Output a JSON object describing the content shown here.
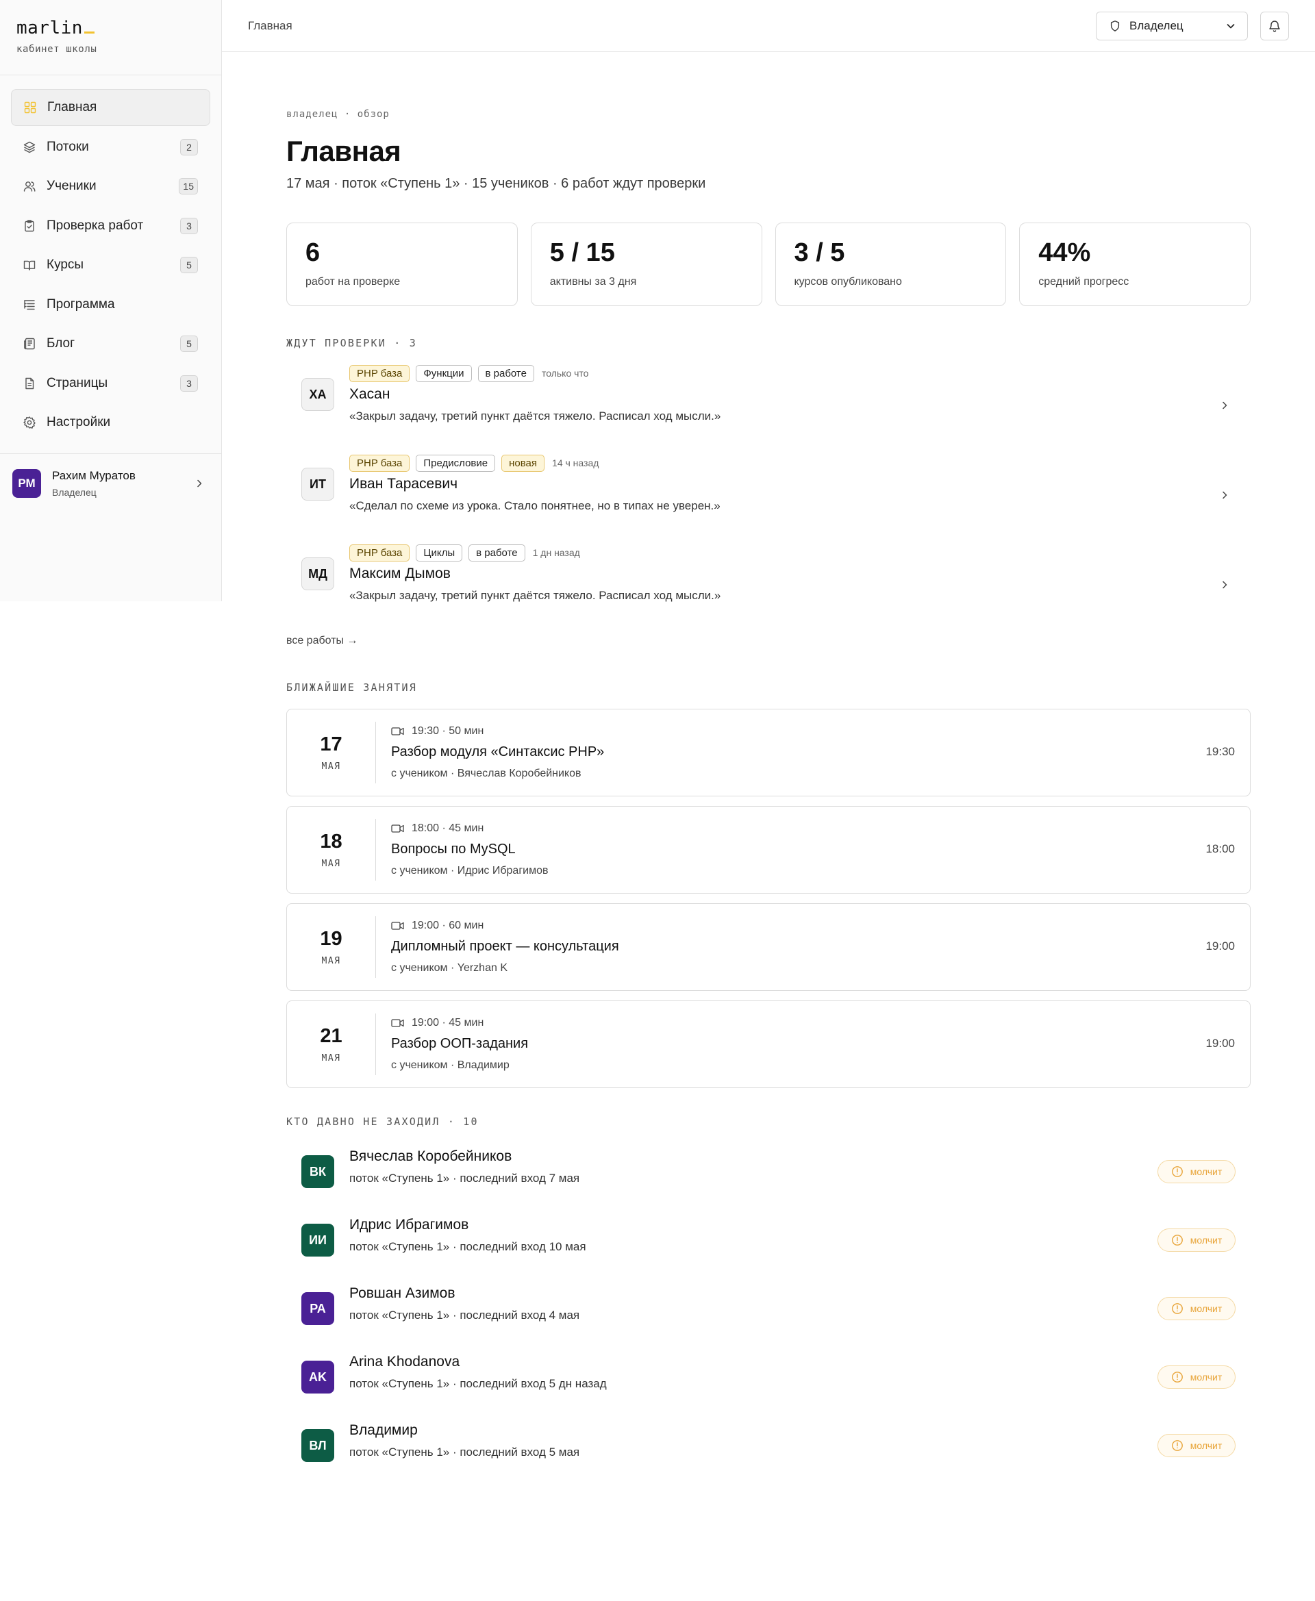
{
  "brand": {
    "name": "marlin",
    "subtitle": "кабинет школы"
  },
  "sidebar": {
    "items": [
      {
        "label": "Главная",
        "icon": "grid-icon",
        "active": true
      },
      {
        "label": "Потоки",
        "icon": "layers-icon",
        "badge": "2"
      },
      {
        "label": "Ученики",
        "icon": "users-icon",
        "badge": "15"
      },
      {
        "label": "Проверка работ",
        "icon": "clipboard-check-icon",
        "badge": "3"
      },
      {
        "label": "Курсы",
        "icon": "book-open-icon",
        "badge": "5"
      },
      {
        "label": "Программа",
        "icon": "list-tree-icon"
      },
      {
        "label": "Блог",
        "icon": "newspaper-icon",
        "badge": "5"
      },
      {
        "label": "Страницы",
        "icon": "file-text-icon",
        "badge": "3"
      },
      {
        "label": "Настройки",
        "icon": "gear-icon"
      }
    ],
    "profile": {
      "initials": "РМ",
      "name": "Рахим Муратов",
      "role": "Владелец"
    }
  },
  "topbar": {
    "breadcrumb": "Главная",
    "role_select": "Владелец"
  },
  "main": {
    "eyebrow": "владелец · обзор",
    "title": "Главная",
    "subtitle": "17 мая · поток «Ступень 1» · 15 учеников · 6 работ ждут проверки",
    "stats": [
      {
        "value": "6",
        "label": "работ на проверке"
      },
      {
        "value": "5 / 15",
        "label": "активны за 3 дня"
      },
      {
        "value": "3 / 5",
        "label": "курсов опубликовано"
      },
      {
        "value": "44%",
        "label": "средний прогресс"
      }
    ],
    "reviews_heading": "ЖДУТ ПРОВЕРКИ · 3",
    "reviews": [
      {
        "initials": "ХА",
        "course": "PHP база",
        "lesson": "Функции",
        "status": "в работе",
        "status_highlight": false,
        "time": "только что",
        "name": "Хасан",
        "quote": "«Закрыл задачу, третий пункт даётся тяжело. Расписал ход мысли.»"
      },
      {
        "initials": "ИТ",
        "course": "PHP база",
        "lesson": "Предисловие",
        "status": "новая",
        "status_highlight": true,
        "time": "14 ч назад",
        "name": "Иван Тарасевич",
        "quote": "«Сделал по схеме из урока. Стало понятнее, но в типах не уверен.»"
      },
      {
        "initials": "МД",
        "course": "PHP база",
        "lesson": "Циклы",
        "status": "в работе",
        "status_highlight": false,
        "time": "1 дн назад",
        "name": "Максим Дымов",
        "quote": "«Закрыл задачу, третий пункт даётся тяжело. Расписал ход мысли.»"
      }
    ],
    "all_works_link": "все работы →",
    "lessons_heading": "БЛИЖАЙШИЕ ЗАНЯТИЯ",
    "lessons": [
      {
        "day": "17",
        "month": "МАЯ",
        "meta": "19:30 · 50 мин",
        "title": "Разбор модуля «Синтаксис PHP»",
        "with": "с учеником · Вячеслав Коробейников",
        "time": "19:30"
      },
      {
        "day": "18",
        "month": "МАЯ",
        "meta": "18:00 · 45 мин",
        "title": "Вопросы по MySQL",
        "with": "с учеником · Идрис Ибрагимов",
        "time": "18:00"
      },
      {
        "day": "19",
        "month": "МАЯ",
        "meta": "19:00 · 60 мин",
        "title": "Дипломный проект — консультация",
        "with": "с учеником · Yerzhan K",
        "time": "19:00"
      },
      {
        "day": "21",
        "month": "МАЯ",
        "meta": "19:00 · 45 мин",
        "title": "Разбор ООП-задания",
        "with": "с учеником · Владимир",
        "time": "19:00"
      }
    ],
    "absent_heading": "КТО ДАВНО НЕ ЗАХОДИЛ · 10",
    "absent": [
      {
        "initials": "ВК",
        "color": "#0d5c45",
        "name": "Вячеслав Коробейников",
        "sub": "поток «Ступень 1» · последний вход 7 мая",
        "status": "молчит"
      },
      {
        "initials": "ИИ",
        "color": "#0d5c45",
        "name": "Идрис Ибрагимов",
        "sub": "поток «Ступень 1» · последний вход 10 мая",
        "status": "молчит"
      },
      {
        "initials": "РА",
        "color": "#4a2195",
        "name": "Ровшан Азимов",
        "sub": "поток «Ступень 1» · последний вход 4 мая",
        "status": "молчит"
      },
      {
        "initials": "AK",
        "color": "#4a2195",
        "name": "Arina Khodanova",
        "sub": "поток «Ступень 1» · последний вход 5 дн назад",
        "status": "молчит"
      },
      {
        "initials": "ВЛ",
        "color": "#0d5c45",
        "name": "Владимир",
        "sub": "поток «Ступень 1» · последний вход 5 мая",
        "status": "молчит"
      }
    ]
  },
  "colors": {
    "accent_yellow": "#f2c230",
    "avatar_green": "#0d5c45",
    "avatar_purple": "#4a2195",
    "silent_orange": "#e8a53a"
  }
}
